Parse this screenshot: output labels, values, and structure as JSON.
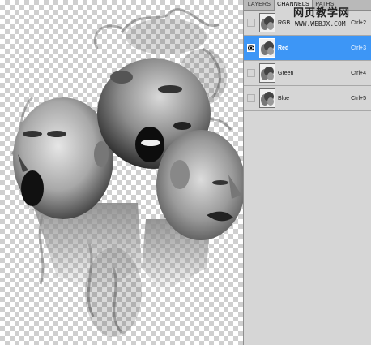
{
  "tabs": {
    "layers": "LAYERS",
    "channels": "CHANNELS",
    "paths": "PATHS"
  },
  "channels": [
    {
      "name": "RGB",
      "shortcut": "Ctrl+2",
      "selected": false,
      "visible": false
    },
    {
      "name": "Red",
      "shortcut": "Ctrl+3",
      "selected": true,
      "visible": true
    },
    {
      "name": "Green",
      "shortcut": "Ctrl+4",
      "selected": false,
      "visible": false
    },
    {
      "name": "Blue",
      "shortcut": "Ctrl+5",
      "selected": false,
      "visible": false
    }
  ],
  "watermark": {
    "text": "网页教学网",
    "url": "WWW.WEBJX.COM"
  },
  "colors": {
    "selection": "#3d96f6",
    "panel": "#d6d6d6"
  }
}
